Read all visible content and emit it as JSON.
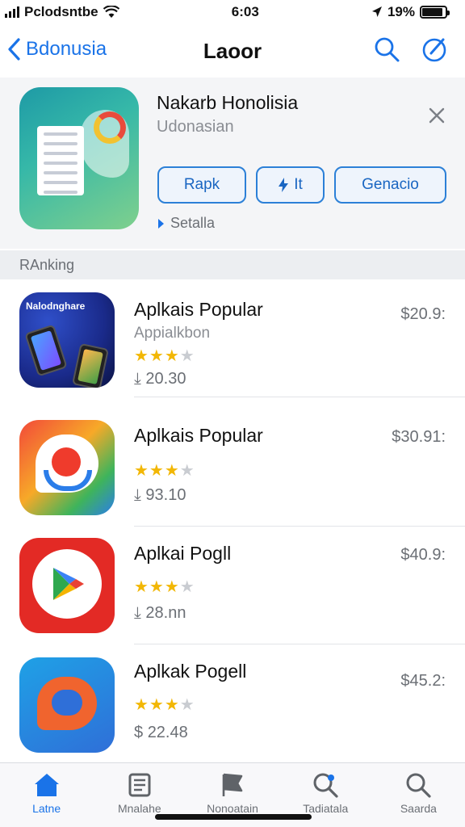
{
  "status_bar": {
    "carrier": "Pclodsntbe",
    "time": "6:03",
    "battery": "19%"
  },
  "nav": {
    "back_label": "Bdonusia",
    "title": "Laoor"
  },
  "header_app": {
    "name": "Nakarb Honolisia",
    "subtitle": "Udonasian",
    "buttons": [
      "Rapk",
      "It",
      "Genacio"
    ],
    "details_label": "Setalla"
  },
  "section": {
    "title": "RAnking"
  },
  "apps": [
    {
      "title": "Aplkais Popular",
      "subtitle": "Appialkbon",
      "rating": 3.5,
      "meta": "20.30",
      "price": "$20.9:",
      "icon_text": "Nalodnghare",
      "icon": "phones-icon"
    },
    {
      "title": "Aplkais Popular",
      "subtitle": "",
      "rating": 3.5,
      "meta": "93.10",
      "price": "$30.91:",
      "icon": "chat-g-icon"
    },
    {
      "title": "Aplkai Pogll",
      "subtitle": "",
      "rating": 3.5,
      "meta": "28.nn",
      "price": "$40.9:",
      "icon": "play-store-icon"
    },
    {
      "title": "Aplkak Pogell",
      "subtitle": "",
      "rating": 3.5,
      "meta": "22.48",
      "price": "$45.2:",
      "icon": "message-icon"
    }
  ],
  "tabs": [
    {
      "label": "Latne",
      "icon": "home-icon",
      "active": true
    },
    {
      "label": "Mnalahe",
      "icon": "newspaper-icon",
      "active": false
    },
    {
      "label": "Nonoatain",
      "icon": "flag-icon",
      "active": false
    },
    {
      "label": "Tadiatala",
      "icon": "search-dot-icon",
      "active": false
    },
    {
      "label": "Saarda",
      "icon": "search-icon",
      "active": false
    }
  ],
  "colors": {
    "accent": "#1a73e8",
    "star": "#f2b705",
    "header_bg": "#f4f5f7"
  }
}
